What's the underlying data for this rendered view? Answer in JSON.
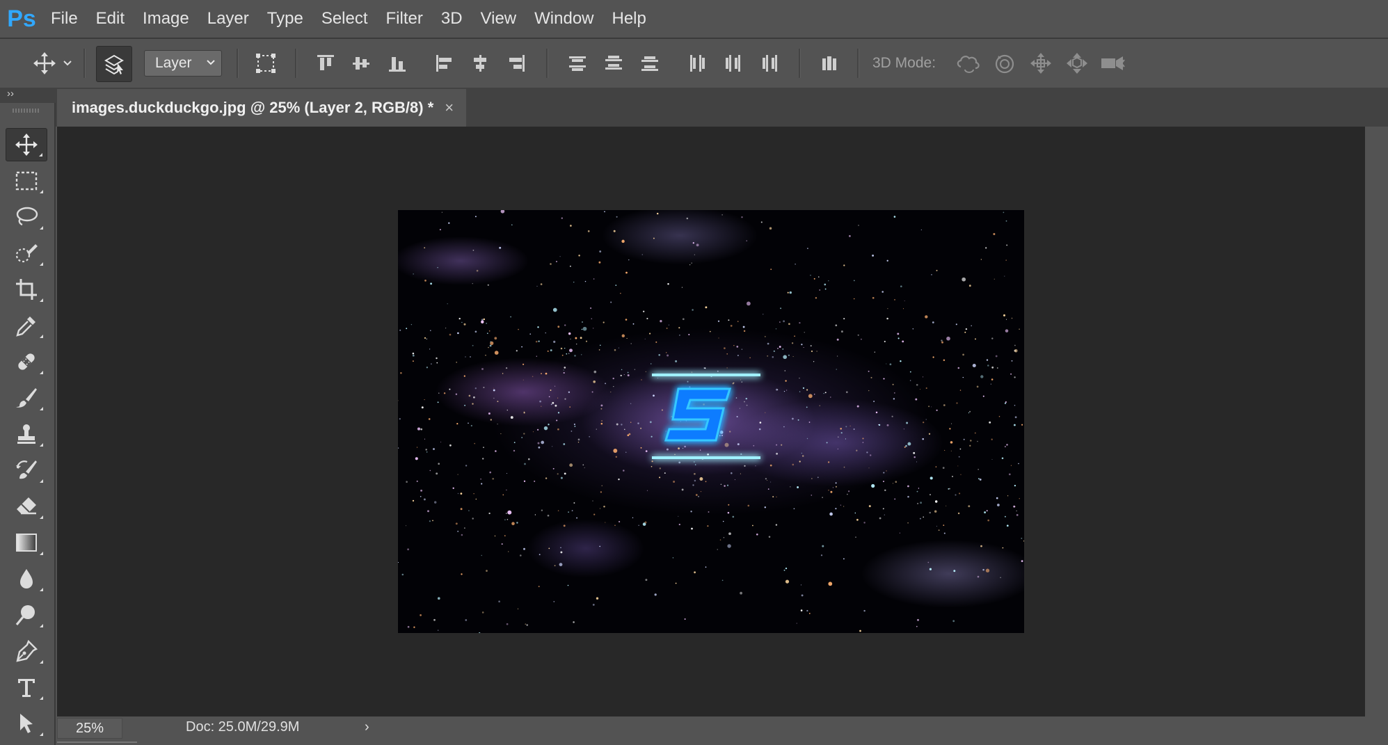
{
  "app": {
    "logo": "Ps",
    "accent": "#31a8ff"
  },
  "menu": [
    "File",
    "Edit",
    "Image",
    "Layer",
    "Type",
    "Select",
    "Filter",
    "3D",
    "View",
    "Window",
    "Help"
  ],
  "options": {
    "auto_select_value": "Layer",
    "mode3d_label": "3D Mode:",
    "icons": [
      "move-tool-icon",
      "auto-select-icon",
      "transform-controls-icon",
      "align-top-icon",
      "align-vertical-center-icon",
      "align-bottom-icon",
      "align-left-icon",
      "align-horizontal-center-icon",
      "align-right-icon",
      "distribute-top-icon",
      "distribute-vertical-center-icon",
      "distribute-bottom-icon",
      "distribute-left-icon",
      "distribute-horizontal-center-icon",
      "distribute-right-icon",
      "auto-align-icon",
      "rotate-3d-icon",
      "roll-3d-icon",
      "drag-3d-icon",
      "slide-3d-icon",
      "scale-3d-icon"
    ]
  },
  "document": {
    "tab_title": "images.duckduckgo.jpg @ 25% (Layer 2, RGB/8) *",
    "close_glyph": "×"
  },
  "toolbox": {
    "collapse_glyph": "››",
    "tools": [
      "move",
      "rectangular-marquee",
      "lasso",
      "quick-selection",
      "crop",
      "eyedropper",
      "healing-brush",
      "brush",
      "clone-stamp",
      "history-brush",
      "eraser",
      "gradient",
      "blur",
      "dodge",
      "pen",
      "type",
      "path-selection"
    ]
  },
  "status": {
    "zoom": "25%",
    "doc_size": "Doc: 25.0M/29.9M",
    "arrow": "›"
  }
}
